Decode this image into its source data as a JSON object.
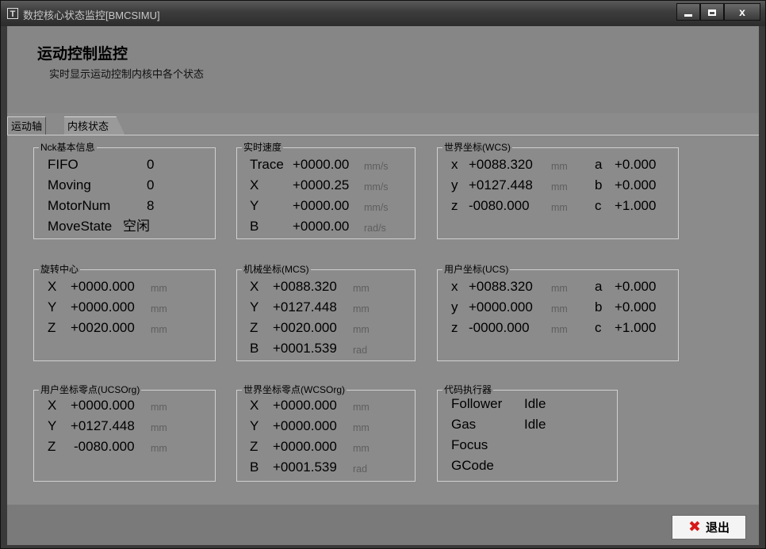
{
  "window": {
    "title": "数控核心状态监控[BMCSIMU]",
    "icon_letter": "T",
    "icon": "app-icon"
  },
  "header": {
    "title": "运动控制监控",
    "subtitle": "实时显示运动控制内核中各个状态"
  },
  "tabs": [
    {
      "label": "运动轴",
      "active": true
    },
    {
      "label": "内核状态",
      "active": false
    }
  ],
  "groups": {
    "nck": {
      "title": "Nck基本信息",
      "rows": [
        {
          "label": "FIFO",
          "value": "0"
        },
        {
          "label": "Moving",
          "value": "0"
        },
        {
          "label": "MotorNum",
          "value": "8"
        },
        {
          "label": "MoveState",
          "value": "空闲"
        }
      ]
    },
    "speed": {
      "title": "实时速度",
      "rows": [
        {
          "label": "Trace",
          "value": "+0000.00",
          "unit": "mm/s"
        },
        {
          "label": "X",
          "value": "+0000.25",
          "unit": "mm/s"
        },
        {
          "label": "Y",
          "value": "+0000.00",
          "unit": "mm/s"
        },
        {
          "label": "B",
          "value": "+0000.00",
          "unit": "rad/s"
        }
      ]
    },
    "wcs": {
      "title": "世界坐标(WCS)",
      "rows": [
        {
          "label": "x",
          "value": "+0088.320",
          "unit": "mm",
          "label2": "a",
          "value2": "+0.000"
        },
        {
          "label": "y",
          "value": "+0127.448",
          "unit": "mm",
          "label2": "b",
          "value2": "+0.000"
        },
        {
          "label": "z",
          "value": "-0080.000",
          "unit": "mm",
          "label2": "c",
          "value2": "+1.000"
        }
      ]
    },
    "rot": {
      "title": "旋转中心",
      "rows": [
        {
          "label": "X",
          "value": "+0000.000",
          "unit": "mm"
        },
        {
          "label": "Y",
          "value": "+0000.000",
          "unit": "mm"
        },
        {
          "label": "Z",
          "value": "+0020.000",
          "unit": "mm"
        }
      ]
    },
    "mcs": {
      "title": "机械坐标(MCS)",
      "rows": [
        {
          "label": "X",
          "value": "+0088.320",
          "unit": "mm"
        },
        {
          "label": "Y",
          "value": "+0127.448",
          "unit": "mm"
        },
        {
          "label": "Z",
          "value": "+0020.000",
          "unit": "mm"
        },
        {
          "label": "B",
          "value": "+0001.539",
          "unit": "rad"
        }
      ]
    },
    "ucs": {
      "title": "用户坐标(UCS)",
      "rows": [
        {
          "label": "x",
          "value": "+0088.320",
          "unit": "mm",
          "label2": "a",
          "value2": "+0.000"
        },
        {
          "label": "y",
          "value": "+0000.000",
          "unit": "mm",
          "label2": "b",
          "value2": "+0.000"
        },
        {
          "label": "z",
          "value": "-0000.000",
          "unit": "mm",
          "label2": "c",
          "value2": "+1.000"
        }
      ]
    },
    "ucsorg": {
      "title": "用户坐标零点(UCSOrg)",
      "rows": [
        {
          "label": "X",
          "value": "+0000.000",
          "unit": "mm"
        },
        {
          "label": "Y",
          "value": "+0127.448",
          "unit": "mm"
        },
        {
          "label": "Z",
          "value": "-0080.000",
          "unit": "mm"
        }
      ]
    },
    "wcsorg": {
      "title": "世界坐标零点(WCSOrg)",
      "rows": [
        {
          "label": "X",
          "value": "+0000.000",
          "unit": "mm"
        },
        {
          "label": "Y",
          "value": "+0000.000",
          "unit": "mm"
        },
        {
          "label": "Z",
          "value": "+0000.000",
          "unit": "mm"
        },
        {
          "label": "B",
          "value": "+0001.539",
          "unit": "rad"
        }
      ]
    },
    "exec": {
      "title": "代码执行器",
      "rows": [
        {
          "label": "Follower",
          "value": "Idle"
        },
        {
          "label": "Gas",
          "value": "Idle"
        },
        {
          "label": "Focus",
          "value": ""
        },
        {
          "label": "GCode",
          "value": ""
        }
      ]
    }
  },
  "footer": {
    "exit_label": "退出",
    "exit_icon": "red-x-icon"
  },
  "colors": {
    "accent_exit_icon": "#d81818",
    "panel_bg": "#8b8b8b"
  }
}
